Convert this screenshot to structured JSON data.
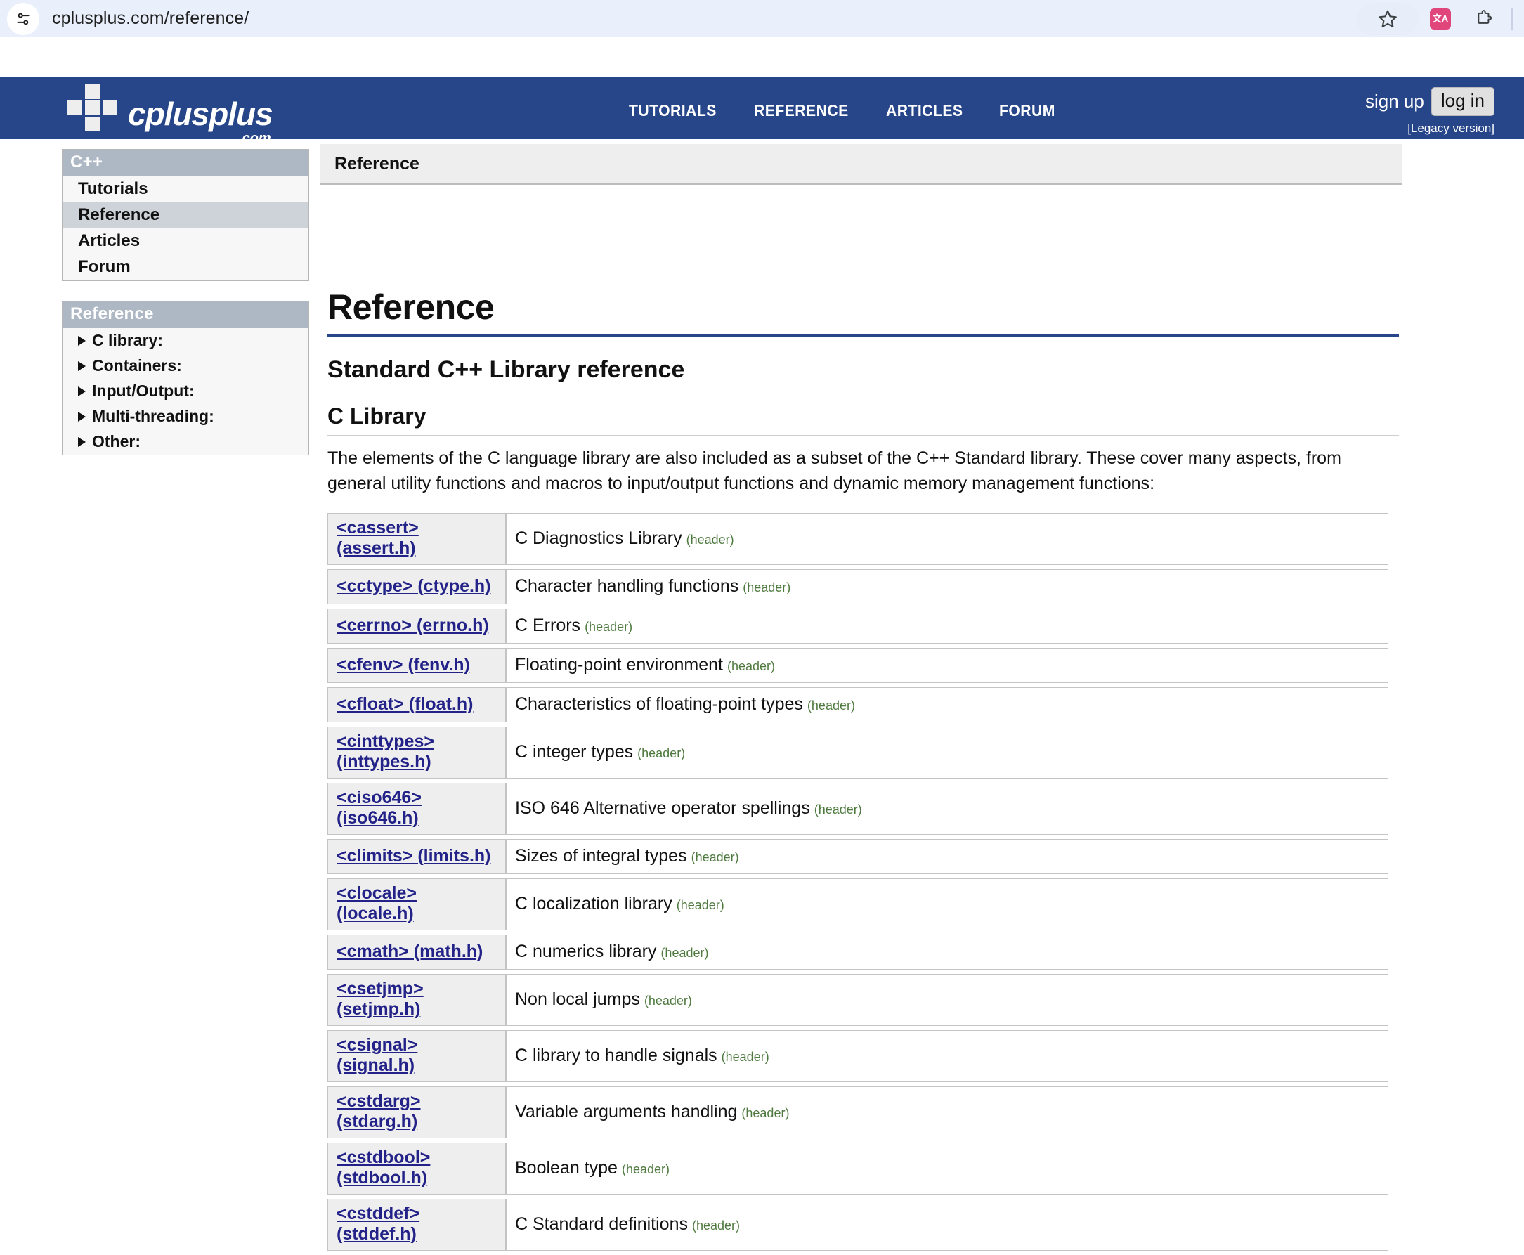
{
  "browser": {
    "url": "cplusplus.com/reference/",
    "page_info_icon": "page-settings-icon",
    "bookmark_icon": "star-icon",
    "translate_icon": "translate-icon",
    "translate_glyph": "文A",
    "extensions_icon": "puzzle-piece-icon"
  },
  "header": {
    "logo_name": "cplusplus",
    "logo_suffix": ".com",
    "nav": [
      {
        "label": "TUTORIALS"
      },
      {
        "label": "REFERENCE"
      },
      {
        "label": "ARTICLES"
      },
      {
        "label": "FORUM"
      }
    ],
    "sign_up": "sign up",
    "log_in": "log in",
    "legacy": "[Legacy version]",
    "brand_color": "#27468a"
  },
  "sidebar": {
    "panels": [
      {
        "title": "C++",
        "items": [
          {
            "label": "Tutorials",
            "active": false
          },
          {
            "label": "Reference",
            "active": true
          },
          {
            "label": "Articles",
            "active": false
          },
          {
            "label": "Forum",
            "active": false
          }
        ]
      },
      {
        "title": "Reference",
        "tree": [
          {
            "label": "C library:"
          },
          {
            "label": "Containers:"
          },
          {
            "label": "Input/Output:"
          },
          {
            "label": "Multi-threading:"
          },
          {
            "label": "Other:"
          }
        ]
      }
    ]
  },
  "main": {
    "breadcrumb": "Reference",
    "page_title": "Reference",
    "section_title": "Standard C++ Library reference",
    "sub_title": "C Library",
    "intro": "The elements of the C language library are also included as a subset of the C++ Standard library. These cover many aspects, from general utility functions and macros to input/output functions and dynamic memory management functions:",
    "tag_label": "(header)",
    "rows": [
      {
        "header": "<cassert> (assert.h)",
        "desc": "C Diagnostics Library"
      },
      {
        "header": "<cctype> (ctype.h)",
        "desc": "Character handling functions"
      },
      {
        "header": "<cerrno> (errno.h)",
        "desc": "C Errors"
      },
      {
        "header": "<cfenv> (fenv.h)",
        "desc": "Floating-point environment"
      },
      {
        "header": "<cfloat> (float.h)",
        "desc": "Characteristics of floating-point types"
      },
      {
        "header": "<cinttypes> (inttypes.h)",
        "desc": "C integer types"
      },
      {
        "header": "<ciso646> (iso646.h)",
        "desc": "ISO 646 Alternative operator spellings"
      },
      {
        "header": "<climits> (limits.h)",
        "desc": "Sizes of integral types"
      },
      {
        "header": "<clocale> (locale.h)",
        "desc": "C localization library"
      },
      {
        "header": "<cmath> (math.h)",
        "desc": "C numerics library"
      },
      {
        "header": "<csetjmp> (setjmp.h)",
        "desc": "Non local jumps"
      },
      {
        "header": "<csignal> (signal.h)",
        "desc": "C library to handle signals"
      },
      {
        "header": "<cstdarg> (stdarg.h)",
        "desc": "Variable arguments handling"
      },
      {
        "header": "<cstdbool> (stdbool.h)",
        "desc": "Boolean type"
      },
      {
        "header": "<cstddef> (stddef.h)",
        "desc": "C Standard definitions"
      }
    ]
  }
}
